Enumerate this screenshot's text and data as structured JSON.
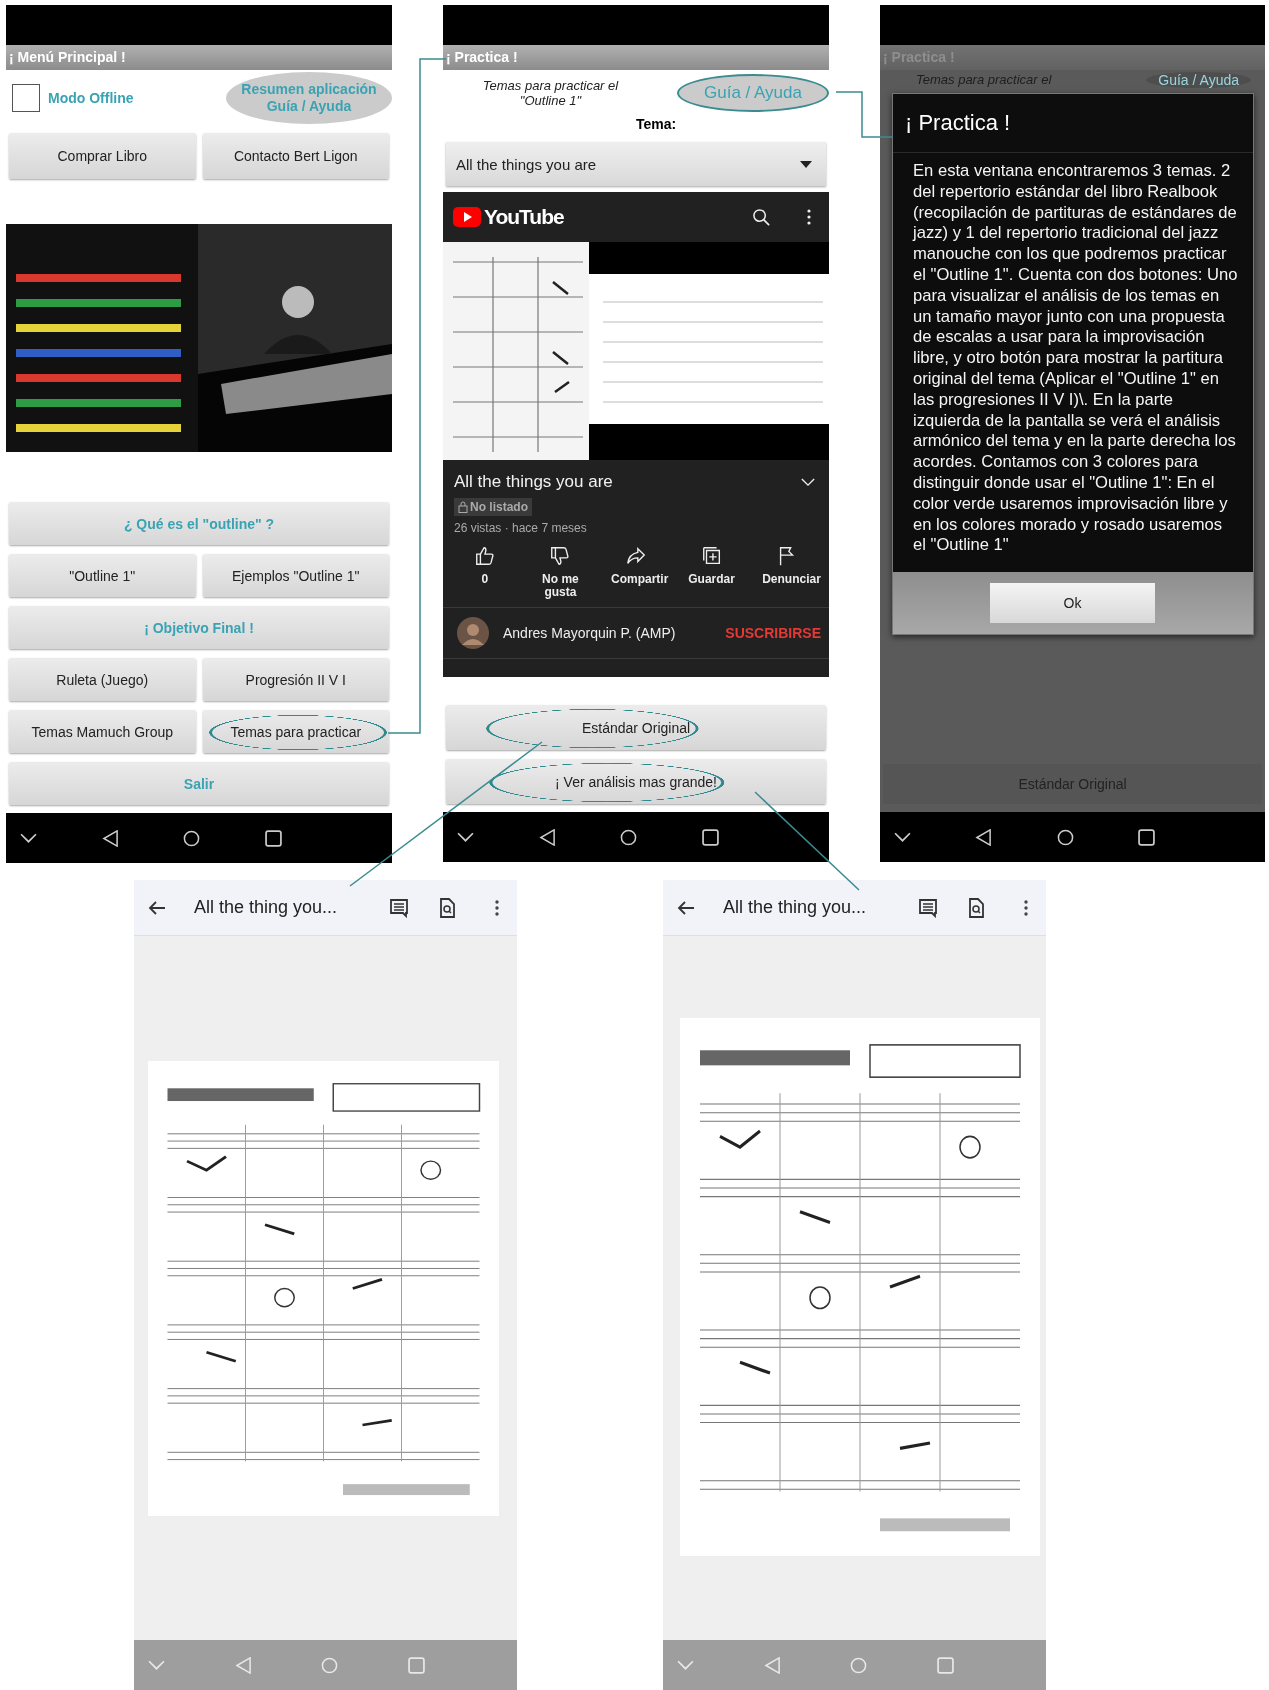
{
  "menu_screen": {
    "title": "¡ Menú Principal !",
    "offline": {
      "label": "Modo Offline",
      "checked": false
    },
    "guide_button": {
      "lines": [
        "Resumen aplicación",
        "Guía / Ayuda"
      ],
      "highlighted": false
    },
    "top_buttons": [
      {
        "label": "Comprar Libro"
      },
      {
        "label": "Contacto Bert Ligon"
      }
    ],
    "cover": {
      "kind": "picture"
    },
    "menu_rows": [
      [
        {
          "label": "¿ Qué es el \"outline\" ?",
          "kind": "accent",
          "highlighted": false
        }
      ],
      [
        {
          "label": "\"Outline 1\"",
          "kind": "plain",
          "highlighted": false
        },
        {
          "label": "Ejemplos \"Outline 1\"",
          "kind": "plain",
          "highlighted": false
        }
      ],
      [
        {
          "label": "¡ Objetivo Final !",
          "kind": "accent",
          "highlighted": false
        }
      ],
      [
        {
          "label": "Ruleta (Juego)",
          "kind": "plain",
          "highlighted": false
        },
        {
          "label": "Progresión II V I",
          "kind": "plain",
          "highlighted": false
        }
      ],
      [
        {
          "label": "Temas Mamuch Group",
          "kind": "plain",
          "highlighted": false
        },
        {
          "label": "Temas para practicar",
          "kind": "plain",
          "highlighted": true
        }
      ],
      [
        {
          "label": "Salir",
          "kind": "accent",
          "highlighted": false
        }
      ]
    ]
  },
  "practice_screen": {
    "title": "¡ Practica !",
    "subtitle_lines": [
      "Temas para practicar el",
      "\"Outline 1\""
    ],
    "guide_button": {
      "label": "Guía / Ayuda",
      "highlighted": true
    },
    "tema_label": "Tema:",
    "dropdown": {
      "value": "All the things you are"
    },
    "youtube": {
      "logo": "YouTube",
      "video": {
        "kind": "picture"
      },
      "title": "All the things you are",
      "badge": "No listado",
      "meta": "26 vistas · hace 7 meses",
      "actions": [
        {
          "kind": "like",
          "label": "0"
        },
        {
          "kind": "dislike",
          "label": "No me gusta"
        },
        {
          "kind": "share",
          "label": "Compartir"
        },
        {
          "kind": "save",
          "label": "Guardar"
        },
        {
          "kind": "flag",
          "label": "Denunciar"
        }
      ],
      "channel": "Andres Mayorquin P. (AMP)",
      "subscribe": "SUSCRIBIRSE"
    },
    "buttons": [
      {
        "label": "Estándar Original",
        "highlighted": true
      },
      {
        "label": "¡ Ver análisis mas grande!",
        "highlighted": true
      }
    ]
  },
  "dialog_screen": {
    "background": {
      "title": "¡ Practica !",
      "subtitle": "Temas para practicar el",
      "guide": "Guía / Ayuda",
      "button": "Estándar Original"
    },
    "dialog": {
      "title": "¡ Practica !",
      "body": "En esta ventana encontraremos 3 temas. 2 del repertorio estándar del libro Realbook (recopilación de partituras de estándares de jazz) y 1 del repertorio tradicional del jazz manouche con los que podremos practicar el \"Outline 1\". Cuenta con dos botones: Uno para visualizar el análisis de los temas en un tamaño mayor junto con una propuesta de escalas a usar para la improvisación libre, y otro botón para mostrar la partitura original del tema (Aplicar el \"Outline 1\" en las progresiones II V I)\\. En la parte izquierda de la pantalla se verá el análisis armónico del tema y en la parte derecha los acordes. Contamos con 3 colores para distinguir donde usar el \"Outline 1\": En el color verde usaremos improvisación libre y en los colores morado y rosado usaremos el \"Outline 1\"",
      "button": "Ok"
    }
  },
  "viewers": [
    {
      "title": "All the thing you...",
      "page": {
        "kind": "picture"
      }
    },
    {
      "title": "All the thing you...",
      "page": {
        "kind": "picture"
      }
    }
  ]
}
